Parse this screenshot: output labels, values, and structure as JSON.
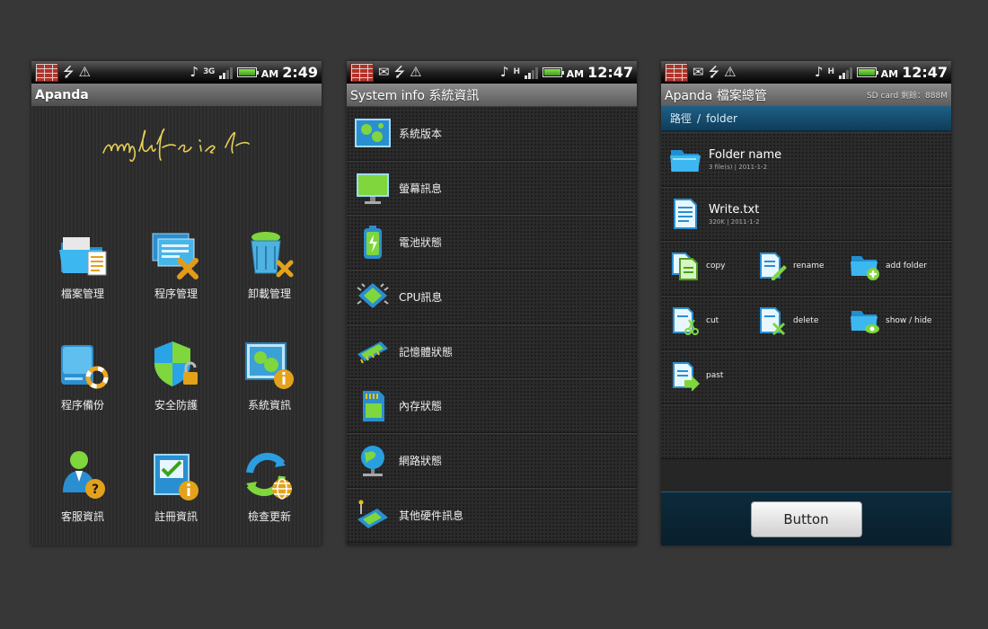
{
  "phone1": {
    "status": {
      "network": "3G",
      "time": "2:49",
      "ampm": "AM"
    },
    "title": "Apanda",
    "grid": [
      {
        "label": "檔案管理",
        "icon": "folder-document-icon"
      },
      {
        "label": "程序管理",
        "icon": "app-tools-icon"
      },
      {
        "label": "卸載管理",
        "icon": "recycle-bin-delete-icon"
      },
      {
        "label": "程序備份",
        "icon": "drive-backup-icon"
      },
      {
        "label": "安全防護",
        "icon": "shield-lock-icon"
      },
      {
        "label": "系統資訊",
        "icon": "system-info-icon"
      },
      {
        "label": "客服資訊",
        "icon": "user-help-icon"
      },
      {
        "label": "註冊資訊",
        "icon": "register-info-icon"
      },
      {
        "label": "檢查更新",
        "icon": "update-globe-icon"
      }
    ]
  },
  "phone2": {
    "status": {
      "network": "H",
      "time": "12:47",
      "ampm": "AM"
    },
    "title": "System info  系統資訊",
    "items": [
      {
        "label": "系統版本",
        "icon": "board-icon"
      },
      {
        "label": "螢幕訊息",
        "icon": "monitor-icon"
      },
      {
        "label": "電池狀態",
        "icon": "battery-icon"
      },
      {
        "label": "CPU訊息",
        "icon": "cpu-icon"
      },
      {
        "label": "記憶體狀態",
        "icon": "memory-icon"
      },
      {
        "label": "內存狀態",
        "icon": "sd-card-icon"
      },
      {
        "label": "網路狀態",
        "icon": "network-globe-icon"
      },
      {
        "label": "其他硬件訊息",
        "icon": "hardware-icon"
      }
    ]
  },
  "phone3": {
    "status": {
      "network": "H",
      "time": "12:47",
      "ampm": "AM"
    },
    "title": "Apanda  檔案總管",
    "sd_info": "SD card 剩餘：888M",
    "breadcrumb": {
      "root": "路徑",
      "sep": "/",
      "folder": "folder"
    },
    "files": [
      {
        "name": "Folder name",
        "meta": "3 file(s) | 2011-1-2",
        "icon": "folder-icon"
      },
      {
        "name": "Write.txt",
        "meta": "320K | 2011-1-2",
        "icon": "text-file-icon"
      }
    ],
    "actions": [
      {
        "label": "copy",
        "icon": "copy-icon"
      },
      {
        "label": "rename",
        "icon": "rename-icon"
      },
      {
        "label": "add folder",
        "icon": "add-folder-icon"
      },
      {
        "label": "cut",
        "icon": "cut-icon"
      },
      {
        "label": "delete",
        "icon": "delete-icon"
      },
      {
        "label": "show / hide",
        "icon": "show-hide-icon"
      },
      {
        "label": "past",
        "icon": "paste-icon"
      }
    ],
    "button_label": "Button"
  }
}
